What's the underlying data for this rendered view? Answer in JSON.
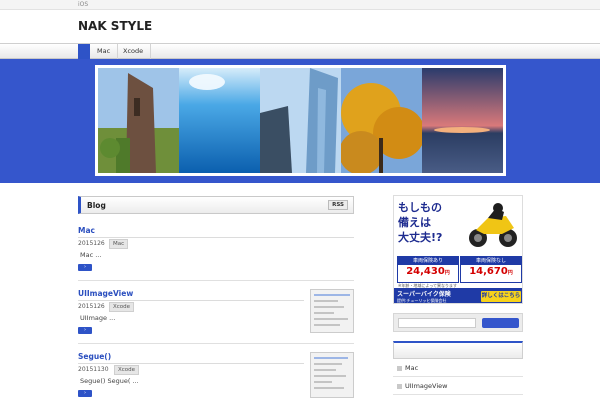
{
  "topbar": {
    "label": "iOS"
  },
  "header": {
    "site_title": "NAK STYLE"
  },
  "nav": {
    "items": [
      "Mac",
      "Xcode"
    ]
  },
  "main": {
    "box_title": "Blog",
    "rss_label": "RSS",
    "posts": [
      {
        "title": "Mac",
        "date": "2015126",
        "tag": "Mac",
        "excerpt": "Mac ..."
      },
      {
        "title": "UIImageView",
        "date": "2015126",
        "tag": "Xcode",
        "excerpt": "UIImage ..."
      },
      {
        "title": "Segue()",
        "date": "20151130",
        "tag": "Xcode",
        "excerpt": "Segue()  Segue( ..."
      }
    ]
  },
  "ad": {
    "headline_1": "もしもの",
    "headline_2": "備えは",
    "headline_3": "大丈夫!?",
    "left_box_title": "車両保険あり",
    "left_price": "24,430",
    "right_box_title": "車両保険なし",
    "right_price": "14,670",
    "yen": "円",
    "note": "※年齢・地域によって異なります",
    "bottom_line_1": "スーパーバイク保険",
    "bottom_line_2": "提供:チューリッヒ保険会社",
    "cta": "詳しくはこちら",
    "colors": {
      "brand": "#1f3aa6",
      "price": "#d40000",
      "cta": "#f7d21b"
    }
  },
  "sidebar": {
    "items": [
      "Mac",
      "UIImageView"
    ]
  },
  "colors": {
    "accent": "#2e53c7",
    "hero_bg": "#3556cc"
  }
}
